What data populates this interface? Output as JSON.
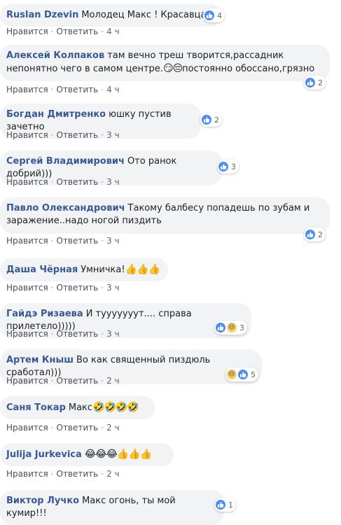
{
  "labels": {
    "like": "Нравится",
    "reply": "Ответить",
    "sep": "·"
  },
  "comments": [
    {
      "author": "Ruslan Dzevin",
      "text": "Молодец Макс ! Красавца!",
      "emoji": "",
      "time": "4 ч",
      "reaction_count": "4",
      "reactions": [
        "like"
      ]
    },
    {
      "author": "Алексей Колпаков",
      "text": "там вечно треш творится,рассадник непонятно чего в самом центре.",
      "emoji": "😏😔",
      "text2": "постоянно обоссано,грязно",
      "time": "4 ч",
      "reaction_count": "2",
      "reactions": [
        "like"
      ]
    },
    {
      "author": "Богдан Дмитренко",
      "text": "юшку пустив зачетно",
      "emoji": "",
      "time": "3 ч",
      "reaction_count": "2",
      "reactions": [
        "like"
      ]
    },
    {
      "author": "Сергей Владимирович",
      "text": "Ото ранок добрий)))",
      "emoji": "",
      "time": "3 ч",
      "reaction_count": "3",
      "reactions": [
        "like"
      ]
    },
    {
      "author": "Павло Олександрович",
      "text": "Такому балбесу попадешь по зубам и заражение..надо ногой пиздить",
      "emoji": "",
      "time": "3 ч",
      "reaction_count": "2",
      "reactions": [
        "like"
      ]
    },
    {
      "author": "Даша Чёрная",
      "text": "Умничка!",
      "emoji": "👍👍👍",
      "time": "3 ч",
      "reaction_count": "",
      "reactions": []
    },
    {
      "author": "Гайдэ Ризаева",
      "text": "И тууууууут.... справа прилетело)))))",
      "emoji": "",
      "time": "3 ч",
      "reaction_count": "3",
      "reactions": [
        "like",
        "haha"
      ]
    },
    {
      "author": "Артем Кныш",
      "text": "Во как священный пиздюль сработал)))",
      "emoji": "",
      "time": "2 ч",
      "reaction_count": "5",
      "reactions": [
        "haha",
        "like"
      ]
    },
    {
      "author": "Саня Токар",
      "text": "Макс",
      "emoji": "🤣🤣🤣🤣",
      "time": "2 ч",
      "reaction_count": "",
      "reactions": []
    },
    {
      "author": "Julija Jurkevica",
      "text": "",
      "emoji": "😂😂😂👍👍👍",
      "time": "2 ч",
      "reaction_count": "",
      "reactions": []
    },
    {
      "author": "Виктор Лучко",
      "text": "Макс огонь, ты мой кумир!!!",
      "emoji": "",
      "time": "",
      "reaction_count": "1",
      "reactions": [
        "like"
      ]
    }
  ],
  "colors": {
    "author": "#385898",
    "bubble": "#f2f3f5",
    "meta": "#606770",
    "like": "#4a8df8",
    "haha": "#fcd25d"
  }
}
